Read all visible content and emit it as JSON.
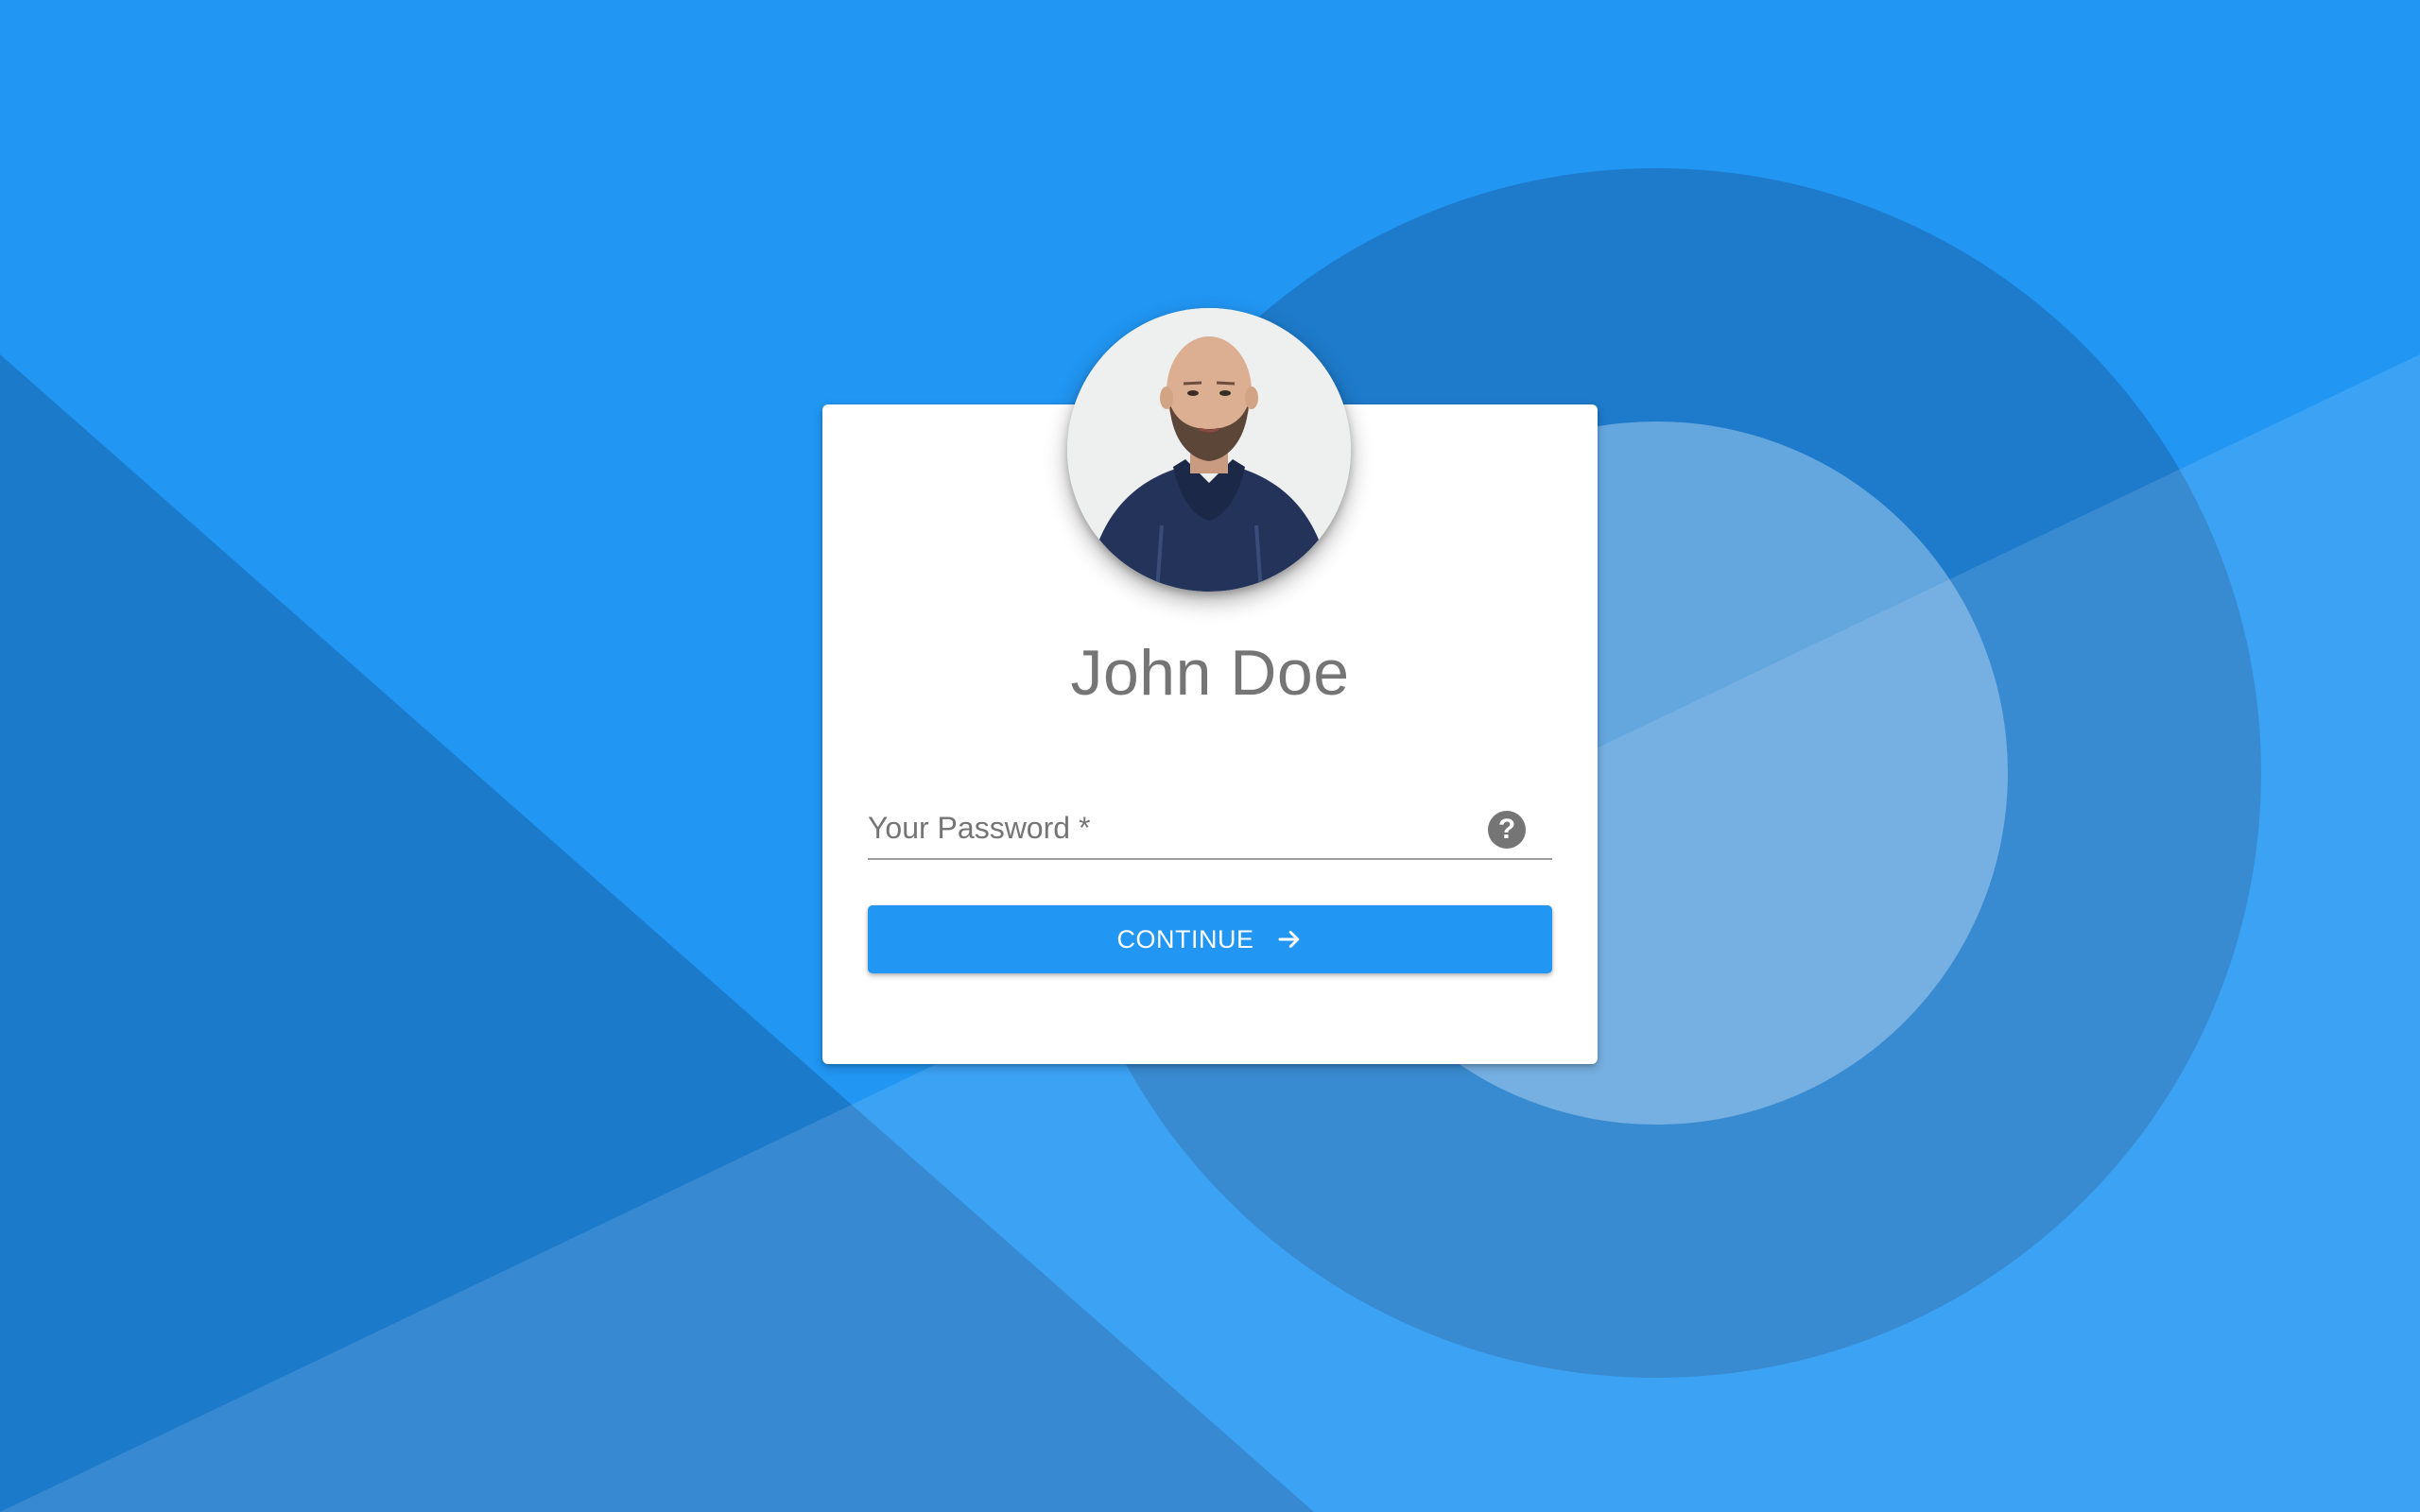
{
  "colors": {
    "background": "#2196F3",
    "background_dark": "#1C7ACB",
    "ring": "#1E78C8",
    "ring_inner_light": "#5C9FDA",
    "card": "#FFFFFF",
    "accent": "#2196F3",
    "text_muted": "#757575"
  },
  "profile": {
    "avatar_icon": "user-photo",
    "name": "John Doe"
  },
  "password_field": {
    "label": "Your Password *",
    "value": "",
    "help_icon": "question-mark-circle-icon",
    "help_glyph": "?"
  },
  "continue_button": {
    "label": "CONTINUE",
    "icon": "arrow-right-icon"
  }
}
